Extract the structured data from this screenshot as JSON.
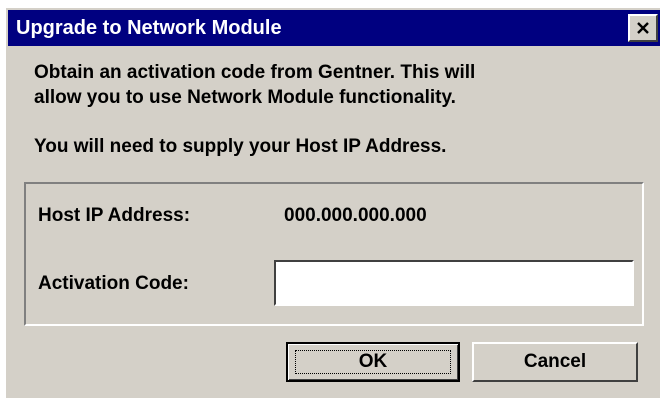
{
  "window": {
    "title": "Upgrade to Network Module",
    "close_icon": "close-icon"
  },
  "message": {
    "line1": "Obtain an activation code from Gentner. This will",
    "line2": "allow you to use Network Module functionality.",
    "line3": "You will need to supply your Host IP Address."
  },
  "fields": {
    "host_ip_label": "Host IP Address:",
    "host_ip_value": "000.000.000.000",
    "activation_code_label": "Activation Code:",
    "activation_code_value": ""
  },
  "buttons": {
    "ok_label": "OK",
    "cancel_label": "Cancel"
  },
  "colors": {
    "titlebar": "#000080",
    "dialog_face": "#d4d0c8",
    "title_text": "#ffffff"
  }
}
